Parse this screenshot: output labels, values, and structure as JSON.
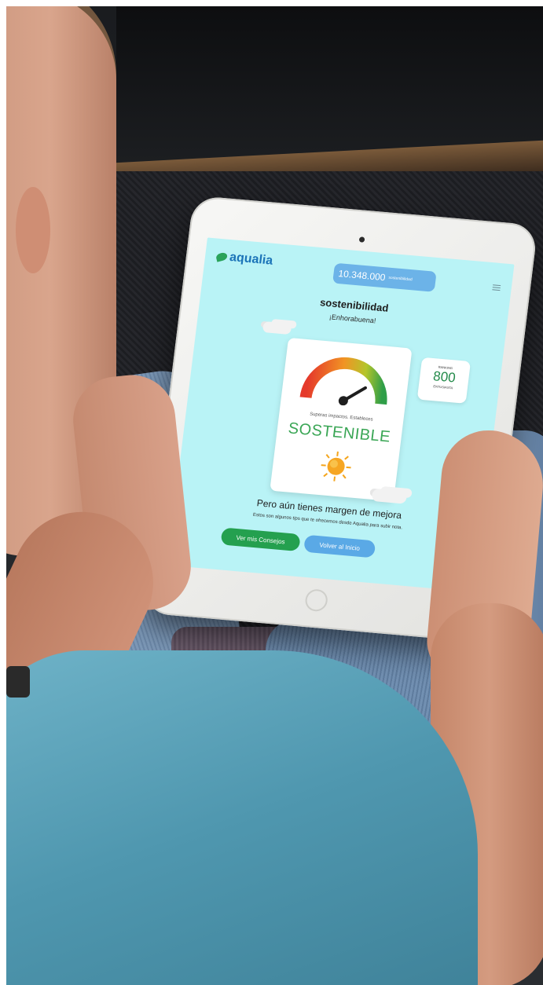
{
  "app": {
    "logo_text": "aqualia",
    "counter": {
      "value": "10.348.000",
      "label": "sostenibilidad"
    },
    "brand_title": "sostenibilidad",
    "congrats": "¡Enhorabuena!",
    "ranking": {
      "label": "RANKING",
      "value": "800",
      "sublabel": "ENTUSIASTA"
    },
    "result": {
      "subtitle": "Superas impactos. Estableces",
      "level": "SOSTENIBLE",
      "gauge_level": 0.8
    },
    "margin_title": "Pero aún tienes margen de mejora",
    "margin_text": "Estos son algunos tips que te ofrecemos desde Aqualia para subir nota.",
    "buttons": {
      "advice": "Ver mis Consejos",
      "home": "Volver al Inicio"
    }
  },
  "colors": {
    "screen_bg": "#b9f3f6",
    "green": "#24a04f",
    "blue": "#5aa9e6",
    "brand_blue": "#1b74b8"
  },
  "icons": [
    "menu-icon",
    "sun-icon",
    "gauge-icon",
    "cloud-icon",
    "logo-icon"
  ]
}
